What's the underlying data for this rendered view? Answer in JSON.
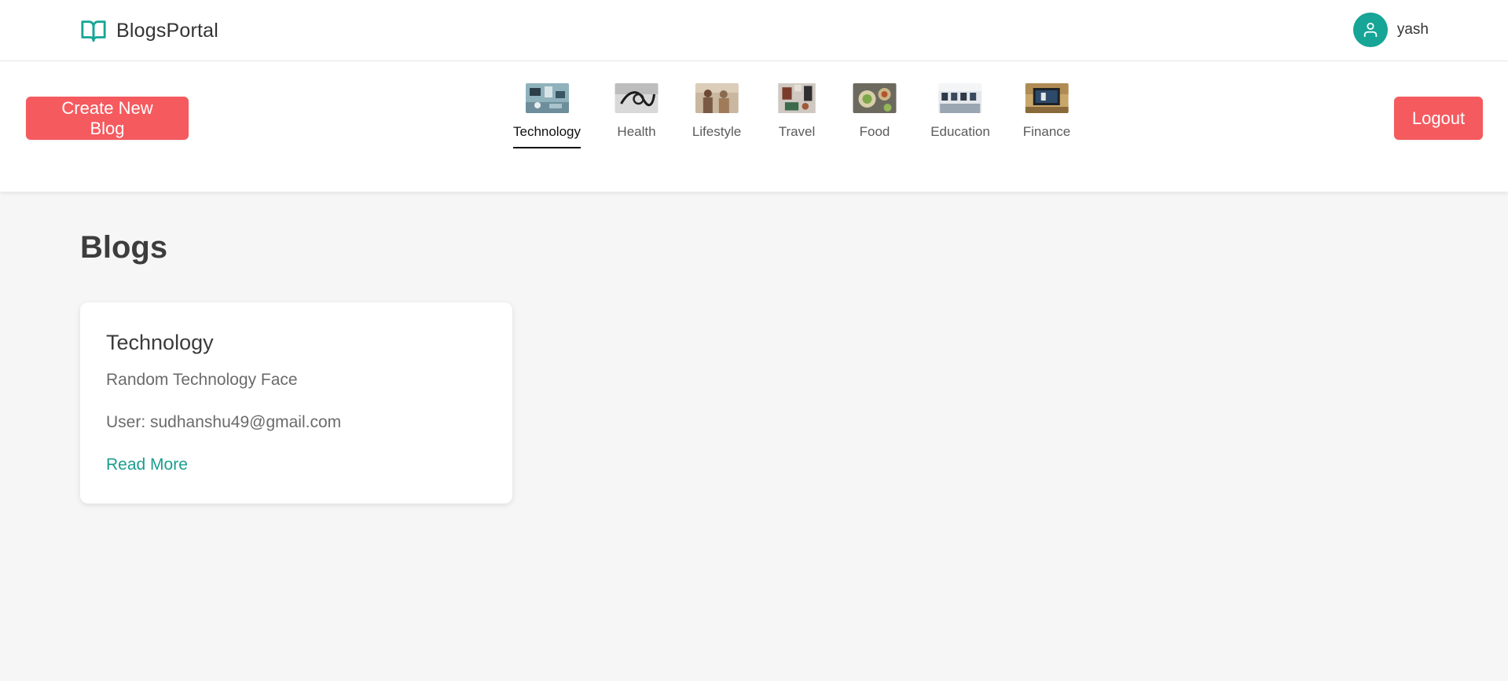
{
  "header": {
    "brand": "BlogsPortal",
    "brand_color": "#16a596",
    "user_name": "yash",
    "avatar_color": "#16a596"
  },
  "toolbar": {
    "create_label": "Create New Blog",
    "logout_label": "Logout",
    "button_color": "#f55a5f"
  },
  "categories": [
    {
      "label": "Technology",
      "active": true
    },
    {
      "label": "Health",
      "active": false
    },
    {
      "label": "Lifestyle",
      "active": false
    },
    {
      "label": "Travel",
      "active": false
    },
    {
      "label": "Food",
      "active": false
    },
    {
      "label": "Education",
      "active": false
    },
    {
      "label": "Finance",
      "active": false
    }
  ],
  "main": {
    "title": "Blogs",
    "blogs": [
      {
        "category": "Technology",
        "description": "Random Technology Face",
        "user": "User: sudhanshu49@gmail.com",
        "link_label": "Read More"
      }
    ]
  }
}
